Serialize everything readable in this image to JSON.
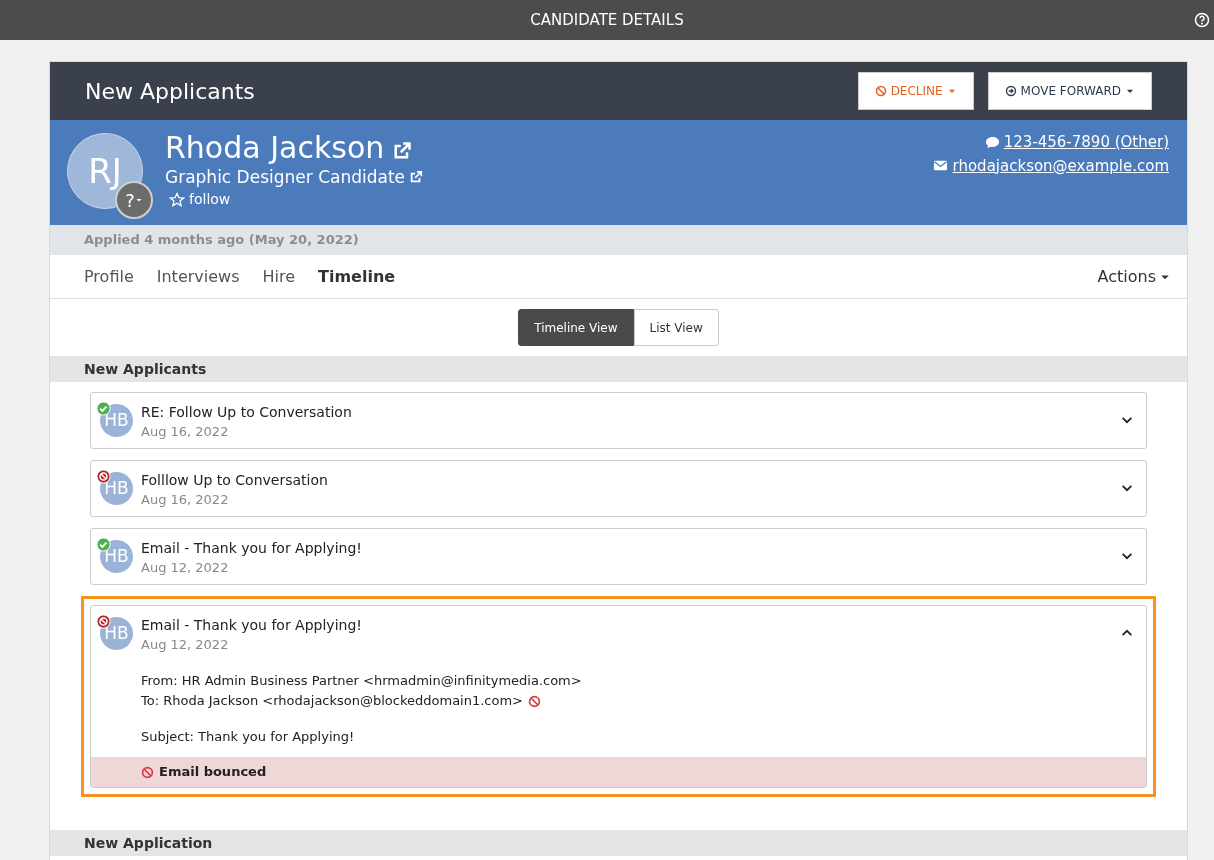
{
  "window": {
    "title": "CANDIDATE DETAILS"
  },
  "header": {
    "stage": "New Applicants",
    "decline_button": "DECLINE",
    "forward_button": "MOVE FORWARD"
  },
  "candidate": {
    "initials": "RJ",
    "status_badge": "?",
    "name": "Rhoda Jackson",
    "position": "Graphic Designer Candidate",
    "follow": "follow",
    "phone": "123-456-7890 (Other)",
    "email": "rhodajackson@example.com"
  },
  "applied": "Applied 4 months ago (May 20, 2022)",
  "tabs": [
    {
      "label": "Profile",
      "selected": false
    },
    {
      "label": "Interviews",
      "selected": false
    },
    {
      "label": "Hire",
      "selected": false
    },
    {
      "label": "Timeline",
      "selected": true
    }
  ],
  "actions_menu": "Actions",
  "view_toggle": [
    {
      "label": "Timeline View",
      "selected": true
    },
    {
      "label": "List View",
      "selected": false
    }
  ],
  "sections": [
    {
      "title": "New Applicants",
      "items": [
        {
          "initials": "HB",
          "kind": "delivered",
          "title": "RE: Follow Up to Conversation",
          "date": "Aug 16, 2022",
          "expanded": false,
          "highlighted": false
        },
        {
          "initials": "HB",
          "kind": "bounced",
          "title": "Folllow Up to Conversation",
          "date": "Aug 16, 2022",
          "expanded": false,
          "highlighted": false
        },
        {
          "initials": "HB",
          "kind": "delivered",
          "title": "Email - Thank you for Applying!",
          "date": "Aug 12, 2022",
          "expanded": false,
          "highlighted": false
        },
        {
          "initials": "HB",
          "kind": "bounced",
          "title": "Email - Thank you for Applying!",
          "date": "Aug 12, 2022",
          "expanded": true,
          "highlighted": true,
          "from": "From: HR Admin Business Partner <hrmadmin@infinitymedia.com>",
          "to": "To: Rhoda Jackson <rhodajackson@blockeddomain1.com>",
          "to_blocked": true,
          "subject": "Subject: Thank you for Applying!",
          "notice": "Email bounced"
        }
      ]
    },
    {
      "title": "New Application"
    }
  ]
}
